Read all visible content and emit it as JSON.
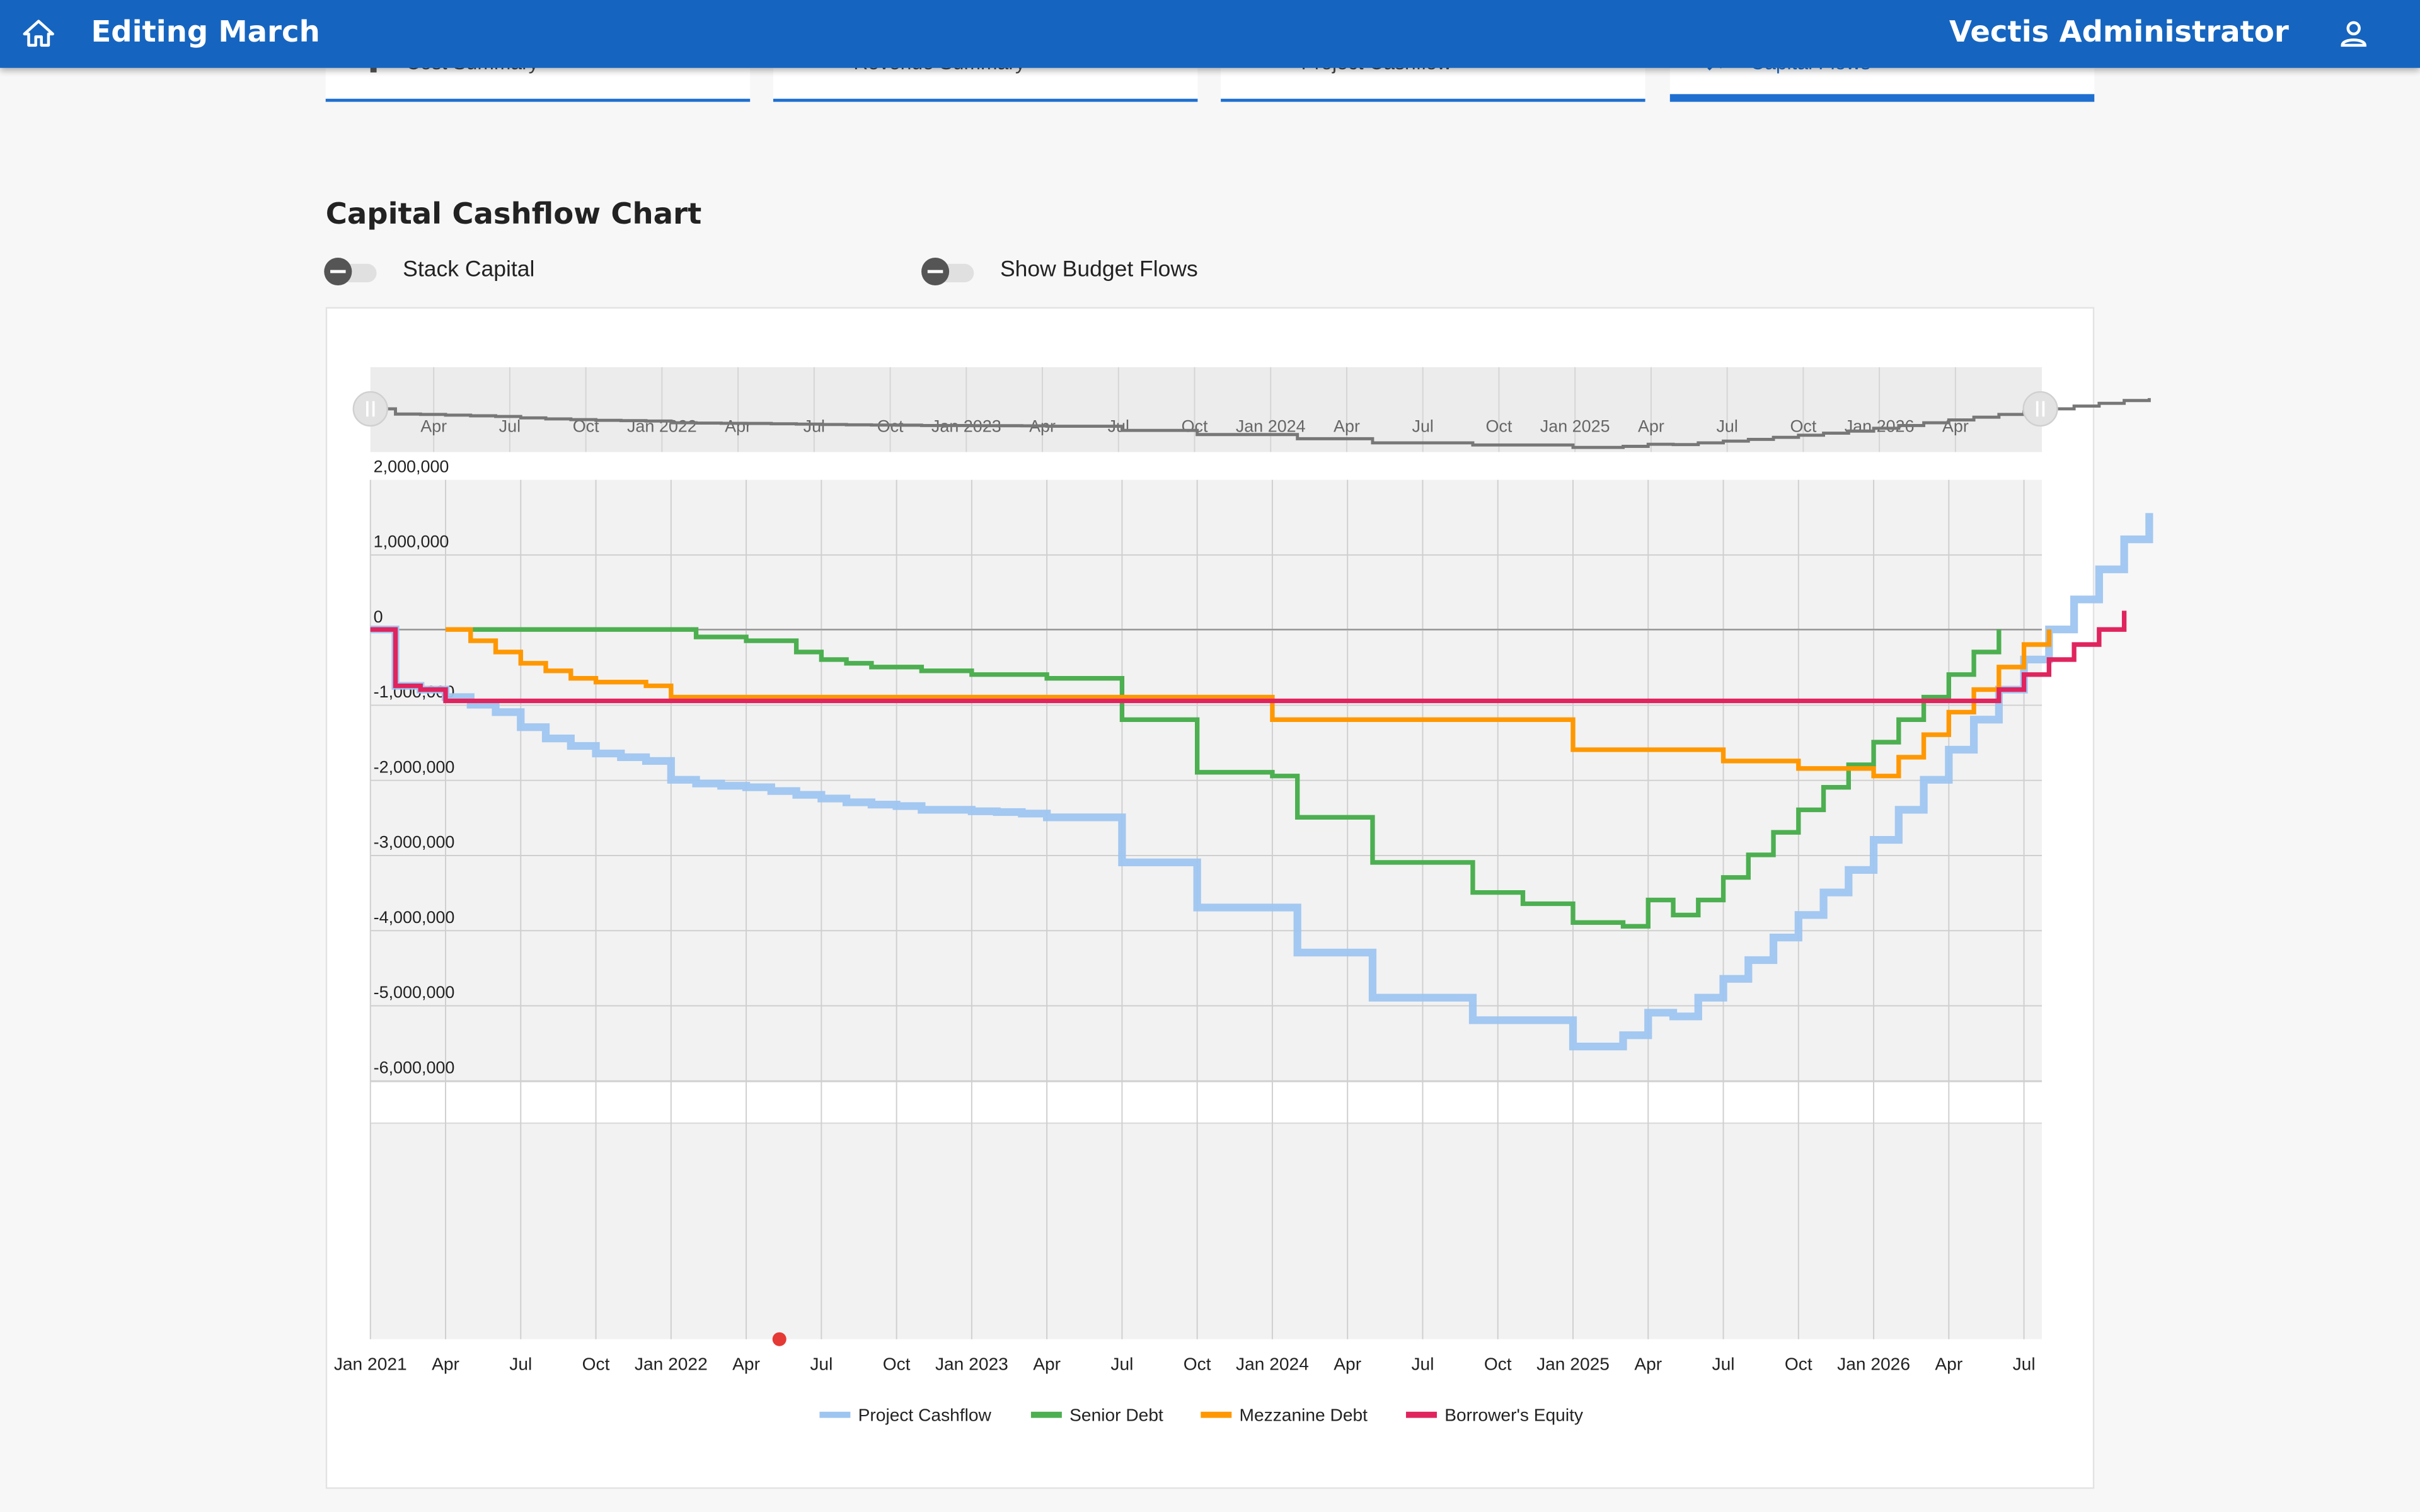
{
  "appbar": {
    "title": "Editing March",
    "user": "Vectis Administrator"
  },
  "tabs": [
    {
      "label": "Cost Summary",
      "icon": "cost-icon",
      "active": false
    },
    {
      "label": "Revenue Summary",
      "icon": "revenue-icon",
      "active": false
    },
    {
      "label": "Project Cashflow",
      "icon": "cashflow-icon",
      "active": false
    },
    {
      "label": "Capital Flows",
      "icon": "trending-icon",
      "active": true
    }
  ],
  "page": {
    "heading": "Capital Cashflow Chart"
  },
  "toggles": [
    {
      "label": "Stack Capital",
      "on": false
    },
    {
      "label": "Show Budget Flows",
      "on": false
    }
  ],
  "colors": {
    "project": "#9ec5f0",
    "senior": "#4caf50",
    "mezz": "#ff9800",
    "equity": "#e0245e",
    "accent": "#1565c0"
  },
  "chart_data": {
    "type": "line",
    "title": "",
    "x_ticks": [
      "Jan 2021",
      "Apr",
      "Jul",
      "Oct",
      "Jan 2022",
      "Apr",
      "Jul",
      "Oct",
      "Jan 2023",
      "Apr",
      "Jul",
      "Oct",
      "Jan 2024",
      "Apr",
      "Jul",
      "Oct",
      "Jan 2025",
      "Apr",
      "Jul",
      "Oct",
      "Jan 2026",
      "Apr",
      "Jul"
    ],
    "y_ticks": [
      "2,000,000",
      "1,000,000",
      "0",
      "-1,000,000",
      "-2,000,000",
      "-3,000,000",
      "-4,000,000",
      "-5,000,000",
      "-6,000,000"
    ],
    "ylim": [
      -6000000,
      2000000
    ],
    "xlim": [
      "2021-01",
      "2026-08"
    ],
    "grid": true,
    "legend_position": "bottom",
    "series": [
      {
        "name": "Project Cashflow",
        "color": "#9ec5f0",
        "points": [
          [
            "2021-01",
            0
          ],
          [
            "2021-02",
            -750000
          ],
          [
            "2021-03",
            -800000
          ],
          [
            "2021-04",
            -900000
          ],
          [
            "2021-05",
            -1000000
          ],
          [
            "2021-06",
            -1100000
          ],
          [
            "2021-07",
            -1300000
          ],
          [
            "2021-08",
            -1450000
          ],
          [
            "2021-09",
            -1550000
          ],
          [
            "2021-10",
            -1650000
          ],
          [
            "2021-11",
            -1700000
          ],
          [
            "2021-12",
            -1750000
          ],
          [
            "2022-01",
            -2000000
          ],
          [
            "2022-02",
            -2050000
          ],
          [
            "2022-03",
            -2080000
          ],
          [
            "2022-04",
            -2100000
          ],
          [
            "2022-05",
            -2150000
          ],
          [
            "2022-06",
            -2200000
          ],
          [
            "2022-07",
            -2250000
          ],
          [
            "2022-08",
            -2300000
          ],
          [
            "2022-09",
            -2330000
          ],
          [
            "2022-10",
            -2350000
          ],
          [
            "2022-11",
            -2400000
          ],
          [
            "2022-12",
            -2400000
          ],
          [
            "2023-01",
            -2420000
          ],
          [
            "2023-02",
            -2430000
          ],
          [
            "2023-03",
            -2450000
          ],
          [
            "2023-04",
            -2500000
          ],
          [
            "2023-05",
            -2500000
          ],
          [
            "2023-06",
            -2500000
          ],
          [
            "2023-07",
            -3100000
          ],
          [
            "2023-08",
            -3100000
          ],
          [
            "2023-09",
            -3100000
          ],
          [
            "2023-10",
            -3700000
          ],
          [
            "2023-11",
            -3700000
          ],
          [
            "2023-12",
            -3700000
          ],
          [
            "2024-01",
            -3700000
          ],
          [
            "2024-02",
            -4300000
          ],
          [
            "2024-03",
            -4300000
          ],
          [
            "2024-04",
            -4300000
          ],
          [
            "2024-05",
            -4900000
          ],
          [
            "2024-06",
            -4900000
          ],
          [
            "2024-07",
            -4900000
          ],
          [
            "2024-08",
            -4900000
          ],
          [
            "2024-09",
            -5200000
          ],
          [
            "2024-10",
            -5200000
          ],
          [
            "2024-11",
            -5200000
          ],
          [
            "2024-12",
            -5200000
          ],
          [
            "2025-01",
            -5550000
          ],
          [
            "2025-02",
            -5550000
          ],
          [
            "2025-03",
            -5400000
          ],
          [
            "2025-04",
            -5100000
          ],
          [
            "2025-05",
            -5150000
          ],
          [
            "2025-06",
            -4900000
          ],
          [
            "2025-07",
            -4650000
          ],
          [
            "2025-08",
            -4400000
          ],
          [
            "2025-09",
            -4100000
          ],
          [
            "2025-10",
            -3800000
          ],
          [
            "2025-11",
            -3500000
          ],
          [
            "2025-12",
            -3200000
          ],
          [
            "2026-01",
            -2800000
          ],
          [
            "2026-02",
            -2400000
          ],
          [
            "2026-03",
            -2000000
          ],
          [
            "2026-04",
            -1600000
          ],
          [
            "2026-05",
            -1200000
          ],
          [
            "2026-06",
            -800000
          ],
          [
            "2026-07",
            -400000
          ],
          [
            "2026-08",
            0
          ],
          [
            "2026-09",
            400000
          ],
          [
            "2026-10",
            800000
          ],
          [
            "2026-11",
            1200000
          ],
          [
            "2026-12",
            1550000
          ]
        ]
      },
      {
        "name": "Senior Debt",
        "color": "#4caf50",
        "points": [
          [
            "2021-05",
            0
          ],
          [
            "2022-01",
            0
          ],
          [
            "2022-02",
            -100000
          ],
          [
            "2022-04",
            -150000
          ],
          [
            "2022-06",
            -300000
          ],
          [
            "2022-07",
            -400000
          ],
          [
            "2022-08",
            -450000
          ],
          [
            "2022-09",
            -500000
          ],
          [
            "2022-11",
            -550000
          ],
          [
            "2023-01",
            -600000
          ],
          [
            "2023-04",
            -650000
          ],
          [
            "2023-07",
            -1200000
          ],
          [
            "2023-10",
            -1900000
          ],
          [
            "2024-01",
            -1950000
          ],
          [
            "2024-02",
            -2500000
          ],
          [
            "2024-05",
            -3100000
          ],
          [
            "2024-09",
            -3500000
          ],
          [
            "2024-11",
            -3650000
          ],
          [
            "2025-01",
            -3900000
          ],
          [
            "2025-03",
            -3950000
          ],
          [
            "2025-04",
            -3600000
          ],
          [
            "2025-05",
            -3800000
          ],
          [
            "2025-06",
            -3600000
          ],
          [
            "2025-07",
            -3300000
          ],
          [
            "2025-08",
            -3000000
          ],
          [
            "2025-09",
            -2700000
          ],
          [
            "2025-10",
            -2400000
          ],
          [
            "2025-11",
            -2100000
          ],
          [
            "2025-12",
            -1800000
          ],
          [
            "2026-01",
            -1500000
          ],
          [
            "2026-02",
            -1200000
          ],
          [
            "2026-03",
            -900000
          ],
          [
            "2026-04",
            -600000
          ],
          [
            "2026-05",
            -300000
          ],
          [
            "2026-06",
            0
          ]
        ]
      },
      {
        "name": "Mezzanine Debt",
        "color": "#ff9800",
        "points": [
          [
            "2021-04",
            0
          ],
          [
            "2021-05",
            -150000
          ],
          [
            "2021-06",
            -300000
          ],
          [
            "2021-07",
            -450000
          ],
          [
            "2021-08",
            -550000
          ],
          [
            "2021-09",
            -650000
          ],
          [
            "2021-10",
            -700000
          ],
          [
            "2021-12",
            -750000
          ],
          [
            "2022-01",
            -900000
          ],
          [
            "2024-01",
            -1200000
          ],
          [
            "2025-01",
            -1600000
          ],
          [
            "2025-07",
            -1750000
          ],
          [
            "2025-10",
            -1850000
          ],
          [
            "2026-01",
            -1950000
          ],
          [
            "2026-02",
            -1700000
          ],
          [
            "2026-03",
            -1400000
          ],
          [
            "2026-04",
            -1100000
          ],
          [
            "2026-05",
            -800000
          ],
          [
            "2026-06",
            -500000
          ],
          [
            "2026-07",
            -200000
          ],
          [
            "2026-08",
            0
          ]
        ]
      },
      {
        "name": "Borrower's Equity",
        "color": "#e0245e",
        "points": [
          [
            "2021-01",
            0
          ],
          [
            "2021-02",
            -750000
          ],
          [
            "2021-03",
            -800000
          ],
          [
            "2021-04",
            -950000
          ],
          [
            "2021-05",
            -950000
          ],
          [
            "2022-06",
            -950000
          ],
          [
            "2026-05",
            -950000
          ],
          [
            "2026-06",
            -800000
          ],
          [
            "2026-07",
            -600000
          ],
          [
            "2026-08",
            -400000
          ],
          [
            "2026-09",
            -200000
          ],
          [
            "2026-10",
            0
          ],
          [
            "2026-11",
            250000
          ]
        ]
      }
    ]
  },
  "navigator": {
    "x_ticks": [
      "Apr",
      "Jul",
      "Oct",
      "Jan 2022",
      "Apr",
      "Jul",
      "Oct",
      "Jan 2023",
      "Apr",
      "Jul",
      "Oct",
      "Jan 2024",
      "Apr",
      "Jul",
      "Oct",
      "Jan 2025",
      "Apr",
      "Jul",
      "Oct",
      "Jan 2026",
      "Apr"
    ]
  }
}
